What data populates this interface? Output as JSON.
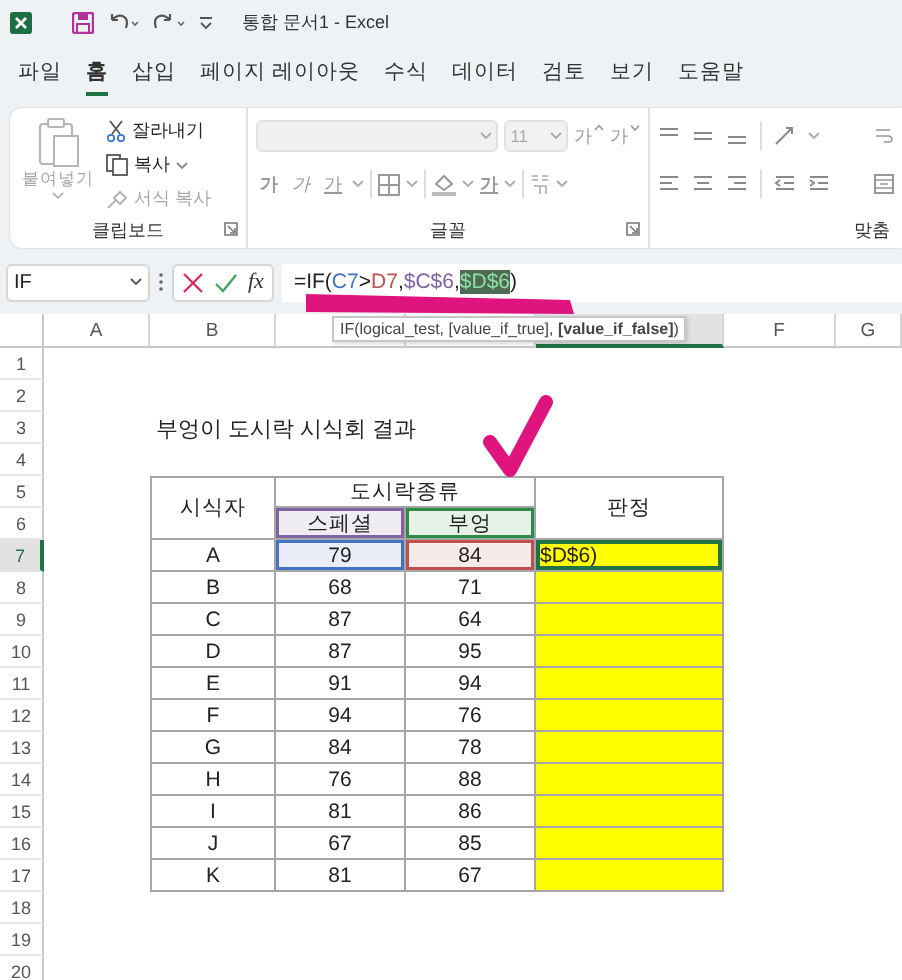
{
  "title_bar": {
    "title": "통합 문서1 - Excel"
  },
  "ribbon_tabs": [
    {
      "label": "파일",
      "selected": false
    },
    {
      "label": "홈",
      "selected": true
    },
    {
      "label": "삽입",
      "selected": false
    },
    {
      "label": "페이지 레이아웃",
      "selected": false
    },
    {
      "label": "수식",
      "selected": false
    },
    {
      "label": "데이터",
      "selected": false
    },
    {
      "label": "검토",
      "selected": false
    },
    {
      "label": "보기",
      "selected": false
    },
    {
      "label": "도움말",
      "selected": false
    }
  ],
  "ribbon": {
    "clipboard": {
      "label": "클립보드",
      "paste": {
        "label": "붙여넣기",
        "disabled": true
      },
      "items": [
        {
          "label": "잘라내기",
          "kind": "cut",
          "disabled": false
        },
        {
          "label": "복사",
          "kind": "copy",
          "disabled": false
        },
        {
          "label": "서식 복사",
          "kind": "format_painter",
          "disabled": true
        }
      ]
    },
    "font": {
      "label": "글꼴",
      "font_name": {
        "disabled": true
      },
      "font_size": "11",
      "size_buttons": [
        {
          "label": "가",
          "kind": "grow"
        },
        {
          "label": "가",
          "kind": "shrink"
        }
      ],
      "style_buttons": [
        {
          "label": "가",
          "kind": "bold"
        },
        {
          "label": "가",
          "kind": "italic"
        },
        {
          "label": "가",
          "kind": "underline"
        }
      ],
      "font_color": {
        "label": "가"
      }
    },
    "alignment": {
      "label": "맞춤"
    }
  },
  "formula_bar": {
    "name_box": "IF",
    "function_button": "fx",
    "formula": [
      {
        "text": "=IF(",
        "kind": "plain",
        "selected": false
      },
      {
        "text": "C7",
        "kind": "ref",
        "color": "#4472c4",
        "selected": false
      },
      {
        "text": ">",
        "kind": "plain",
        "selected": false
      },
      {
        "text": "D7",
        "kind": "ref",
        "color": "#c0504d",
        "selected": false
      },
      {
        "text": ",",
        "kind": "plain",
        "selected": false
      },
      {
        "text": "$C$6",
        "kind": "ref",
        "color": "#8064a2",
        "selected": false
      },
      {
        "text": ",",
        "kind": "plain",
        "selected": false
      },
      {
        "text": "$D$6",
        "kind": "ref",
        "color": "#4d6b55",
        "selected": true
      },
      {
        "text": ")",
        "kind": "plain",
        "selected": false
      }
    ]
  },
  "tooltip": "IF(logical_test, [value_if_true], **[value_if_false]**)",
  "sheet": {
    "columns": [
      {
        "label": "A",
        "selected": false
      },
      {
        "label": "B",
        "selected": false
      },
      {
        "selected": false
      },
      {
        "selected": false
      },
      {
        "selected": true
      },
      {
        "label": "F",
        "selected": false
      },
      {
        "label": "G",
        "selected": false
      }
    ],
    "rows": [
      {
        "label": "1",
        "selected": false
      },
      {
        "label": "2",
        "selected": false
      },
      {
        "label": "3",
        "selected": false
      },
      {
        "label": "4",
        "selected": false
      },
      {
        "label": "5",
        "selected": false
      },
      {
        "label": "6",
        "selected": false
      },
      {
        "label": "7",
        "selected": true
      },
      {
        "label": "8",
        "selected": false
      },
      {
        "label": "9",
        "selected": false
      },
      {
        "label": "10",
        "selected": false
      },
      {
        "label": "11",
        "selected": false
      },
      {
        "label": "12",
        "selected": false
      },
      {
        "label": "13",
        "selected": false
      },
      {
        "label": "14",
        "selected": false
      },
      {
        "label": "15",
        "selected": false
      },
      {
        "label": "16",
        "selected": false
      },
      {
        "label": "17",
        "selected": false
      },
      {
        "label": "18",
        "selected": false
      },
      {
        "label": "19",
        "selected": false
      },
      {
        "label": "20",
        "selected": false
      }
    ],
    "title": "부엉이 도시락 시식회 결과",
    "table": {
      "headers": {
        "taster": "시식자",
        "group": "도시락종류",
        "verdict": "판정",
        "kinds": [
          {
            "label": "스페셜",
            "color": "#8064a2"
          },
          {
            "label": "부엉",
            "color": "#2e8b45"
          }
        ]
      },
      "rows": [
        {
          "taster": "A",
          "scores": [
            {
              "value": "79",
              "color": "#4472c4"
            },
            {
              "value": "84",
              "color": "#c0504d"
            }
          ],
          "verdict": "$D$6)",
          "active": true
        },
        {
          "taster": "B",
          "scores": [
            {
              "value": "68"
            },
            {
              "value": "71"
            }
          ],
          "active": false
        },
        {
          "taster": "C",
          "scores": [
            {
              "value": "87"
            },
            {
              "value": "64"
            }
          ],
          "active": false
        },
        {
          "taster": "D",
          "scores": [
            {
              "value": "87"
            },
            {
              "value": "95"
            }
          ],
          "active": false
        },
        {
          "taster": "E",
          "scores": [
            {
              "value": "91"
            },
            {
              "value": "94"
            }
          ],
          "active": false
        },
        {
          "taster": "F",
          "scores": [
            {
              "value": "94"
            },
            {
              "value": "76"
            }
          ],
          "active": false
        },
        {
          "taster": "G",
          "scores": [
            {
              "value": "84"
            },
            {
              "value": "78"
            }
          ],
          "active": false
        },
        {
          "taster": "H",
          "scores": [
            {
              "value": "76"
            },
            {
              "value": "88"
            }
          ],
          "active": false
        },
        {
          "taster": "I",
          "scores": [
            {
              "value": "81"
            },
            {
              "value": "86"
            }
          ],
          "active": false
        },
        {
          "taster": "J",
          "scores": [
            {
              "value": "67"
            },
            {
              "value": "85"
            }
          ],
          "active": false
        },
        {
          "taster": "K",
          "scores": [
            {
              "value": "81"
            },
            {
              "value": "67"
            }
          ],
          "active": false
        }
      ]
    }
  }
}
